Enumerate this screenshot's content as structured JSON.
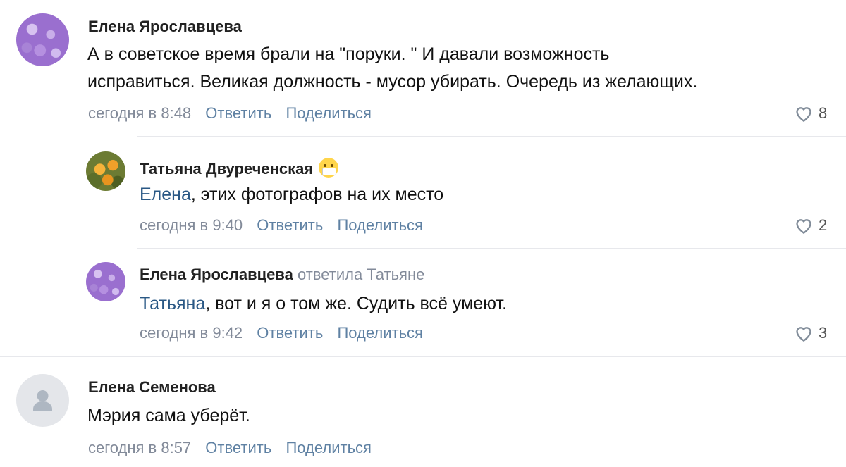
{
  "comments": [
    {
      "author": "Елена Ярославцева",
      "line1": "А в советское время брали на \"поруки. \" И давали возможность",
      "line2": "исправиться. Великая должность - мусор убирать. Очередь из желающих.",
      "time": "сегодня в 8:48",
      "reply": "Ответить",
      "share": "Поделиться",
      "likes": "8",
      "replies": [
        {
          "author": "Татьяна Двуреченская",
          "mention": "Елена",
          "text": ", этих фотографов на их место",
          "time": "сегодня в 9:40",
          "reply": "Ответить",
          "share": "Поделиться",
          "likes": "2"
        },
        {
          "author": "Елена Ярославцева",
          "replied_to": "ответила Татьяне",
          "mention": "Татьяна",
          "text": ", вот и я о том же. Судить всё умеют.",
          "time": "сегодня в 9:42",
          "reply": "Ответить",
          "share": "Поделиться",
          "likes": "3"
        }
      ]
    },
    {
      "author": "Елена Семенова",
      "line1": "Мэрия сама уберёт.",
      "time": "сегодня в 8:57",
      "reply": "Ответить",
      "share": "Поделиться"
    }
  ],
  "icons": {
    "like": "heart-icon",
    "default_avatar": "user-silhouette-icon",
    "emoji": "face-with-mask-emoji"
  },
  "colors": {
    "link": "#2a5885",
    "meta": "#828a99",
    "divider": "#e7e8ec"
  }
}
